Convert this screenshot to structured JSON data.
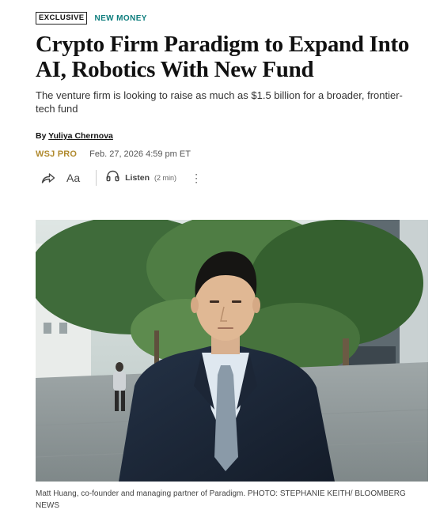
{
  "article": {
    "exclusive_badge": "EXCLUSIVE",
    "section": "NEW MONEY",
    "headline": "Crypto Firm Paradigm to Expand Into AI, Robotics With New Fund",
    "dek": "The venture firm is looking to raise as much as $1.5 billion for a broader, frontier-tech fund",
    "byline_prefix": "By",
    "author": "Yuliya Chernova",
    "publication": "WSJ PRO",
    "timestamp": "Feb. 27, 2026 4:59 pm ET"
  },
  "toolbar": {
    "text_size_label": "Aa",
    "listen_label": "Listen",
    "listen_duration": "(2 min)",
    "more_label": "⋮",
    "icons": [
      "share-icon",
      "text-size-icon",
      "headphones-icon",
      "more-options-icon"
    ]
  },
  "photo": {
    "caption": "Matt Huang, co-founder and managing partner of Paradigm. PHOTO: STEPHANIE KEITH/ BLOOMBERG NEWS"
  },
  "colors": {
    "section_tag": "#0d7d7d",
    "publication": "#b08a2e",
    "text": "#111111"
  }
}
